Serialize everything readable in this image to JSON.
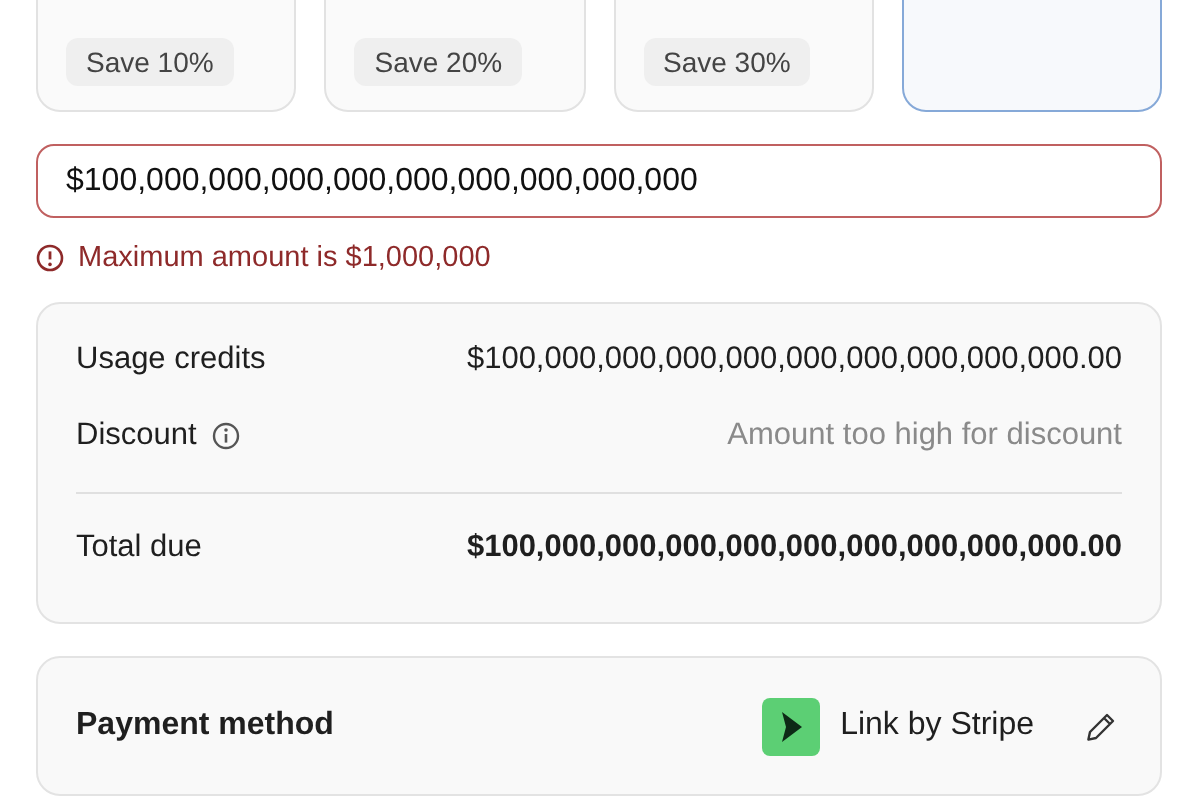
{
  "amount_options": [
    {
      "badge": "Save 10%",
      "selected": false
    },
    {
      "badge": "Save 20%",
      "selected": false
    },
    {
      "badge": "Save 30%",
      "selected": false
    },
    {
      "selected": true
    }
  ],
  "amount_field": {
    "value": "$100,000,000,000,000,000,000,000,000,000",
    "invalid": true
  },
  "error": "Maximum amount is $1,000,000",
  "summary": {
    "rows": [
      {
        "kind": "line",
        "label": "Usage credits",
        "value": "$100,000,000,000,000,000,000,000,000,000.00",
        "info": false,
        "muted": false
      },
      {
        "kind": "line",
        "label": "Discount",
        "value": "Amount too high for discount",
        "info": true,
        "muted": true
      },
      {
        "kind": "total",
        "label": "Total due",
        "value": "$100,000,000,000,000,000,000,000,000,000.00"
      }
    ]
  },
  "payment": {
    "label": "Payment method",
    "provider": "Link by Stripe"
  }
}
